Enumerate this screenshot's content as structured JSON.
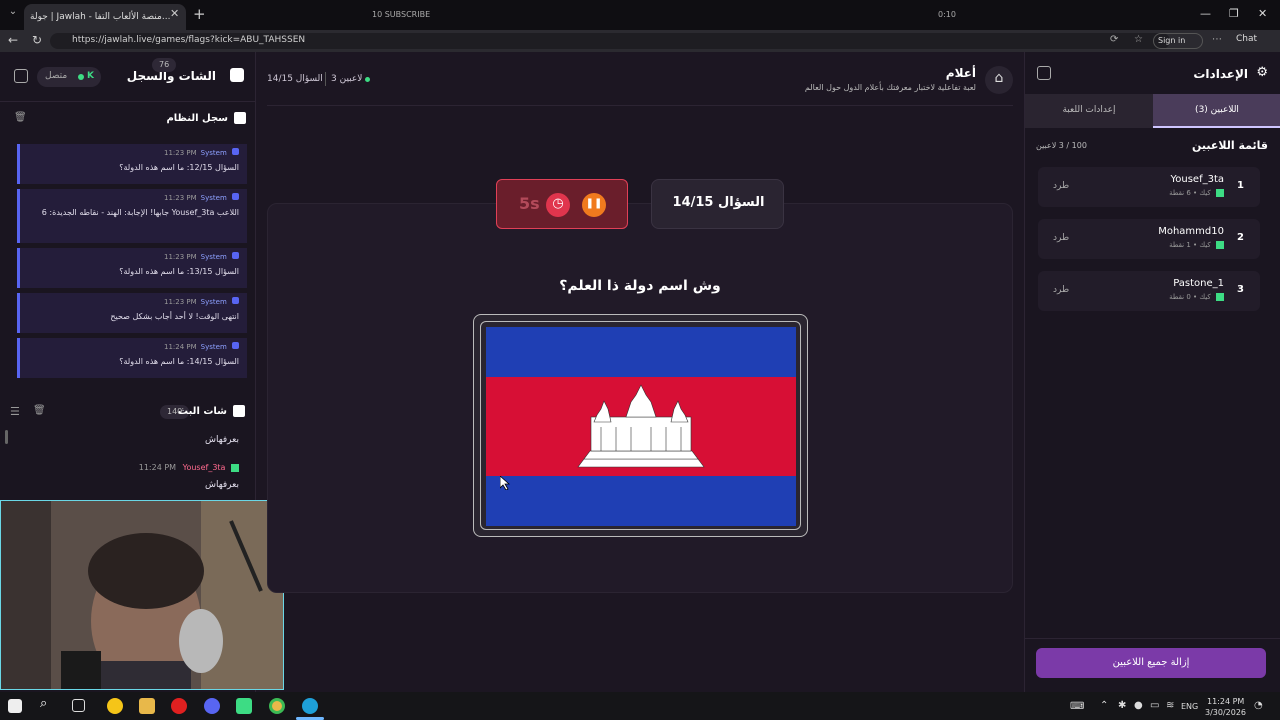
{
  "browser": {
    "tab_title": "جولة | Jawlah - منصة الألعاب التفا...",
    "url": "https://jawlah.live/games/flags?kick=ABU_TAHSSEN",
    "sign_in": "Sign in",
    "chat_label": "Chat",
    "overlay_subscribe": "10 SUBSCRIBE",
    "overlay_timer": "0:10"
  },
  "left_panel": {
    "title": "الشات والسجل",
    "status": "متصل",
    "system_log": {
      "title": "سجل النظام",
      "count": "76",
      "messages": [
        {
          "time": "11:23 PM",
          "sender": "System",
          "text": "السؤال 12/15: ما اسم هذه الدولة؟"
        },
        {
          "time": "11:23 PM",
          "sender": "System",
          "text": "اللاعب Yousef_3ta جابها! الإجابة: الهند - نقاطه الجديدة: 6"
        },
        {
          "time": "11:23 PM",
          "sender": "System",
          "text": "السؤال 13/15: ما اسم هذه الدولة؟"
        },
        {
          "time": "11:23 PM",
          "sender": "System",
          "text": "انتهى الوقت! لا أحد أجاب بشكل صحيح"
        },
        {
          "time": "11:24 PM",
          "sender": "System",
          "text": "السؤال 14/15: ما اسم هذه الدولة؟"
        }
      ]
    },
    "stream_chat": {
      "title": "شات البث",
      "count": "140",
      "messages": [
        {
          "user": "",
          "time": "",
          "text": "بعرفهاش"
        },
        {
          "user": "Yousef_3ta",
          "time": "11:24 PM",
          "text": "بعرفهاش"
        }
      ]
    }
  },
  "main": {
    "players_online": "3 لاعبين",
    "question_progress": "السؤال 14/15",
    "game_title": "أعلام",
    "game_subtitle": "لعبة تفاعلية لاختبار معرفتك بأعلام الدول حول العالم",
    "timer": "5s",
    "question_box": "السؤال 14/15",
    "prompt": "وش اسم دولة ذا العلم؟",
    "flag": {
      "country_colors": {
        "blue": "#1f3fb4",
        "red": "#d70f35",
        "white": "#ffffff"
      }
    }
  },
  "right_panel": {
    "title": "الإعدادات",
    "tabs": [
      {
        "label": "إعدادات اللعبة"
      },
      {
        "label": "اللاعبين (3)"
      }
    ],
    "players_title": "قائمة اللاعبين",
    "players_count": "100 / 3 لاعبين",
    "players": [
      {
        "rank": "1",
        "name": "Yousef_3ta",
        "detail": "كيك • 6 نقطة",
        "kick": "طرد"
      },
      {
        "rank": "2",
        "name": "Mohammd10",
        "detail": "كيك • 1 نقطة",
        "kick": "طرد"
      },
      {
        "rank": "3",
        "name": "Pastone_1",
        "detail": "كيك • 0 نقطة",
        "kick": "طرد"
      }
    ],
    "remove_all": "إزالة جميع اللاعبين"
  },
  "taskbar": {
    "lang": "ENG",
    "time": "11:24 PM",
    "date": "3/30/2026"
  }
}
